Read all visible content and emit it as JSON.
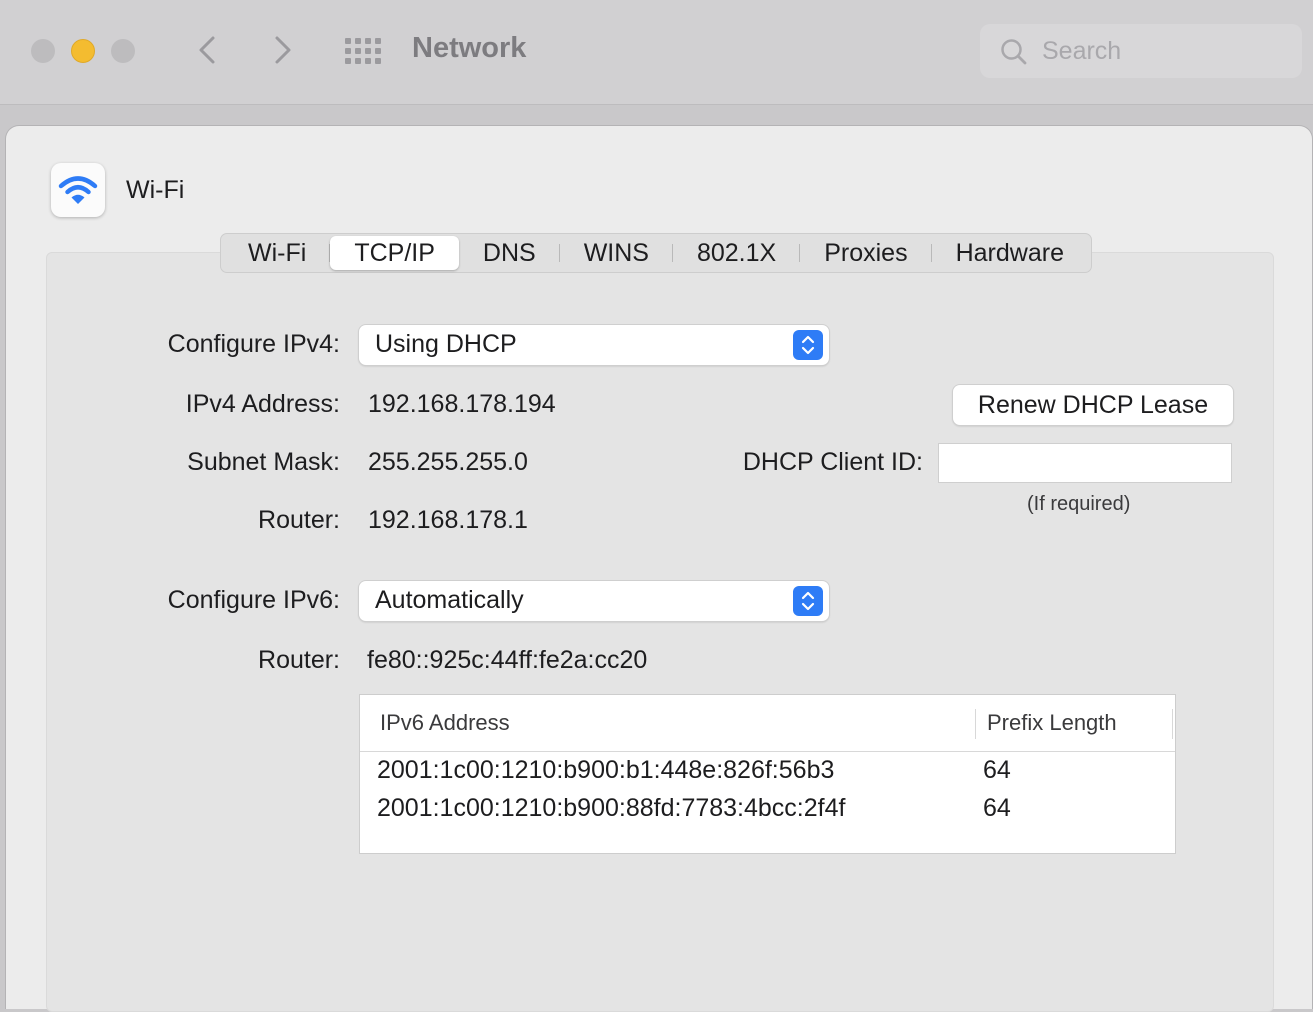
{
  "window": {
    "title": "Network",
    "search_placeholder": "Search"
  },
  "interface": {
    "name": "Wi-Fi",
    "icon": "wifi-icon"
  },
  "tabs": [
    {
      "label": "Wi-Fi",
      "active": false
    },
    {
      "label": "TCP/IP",
      "active": true
    },
    {
      "label": "DNS",
      "active": false
    },
    {
      "label": "WINS",
      "active": false
    },
    {
      "label": "802.1X",
      "active": false
    },
    {
      "label": "Proxies",
      "active": false
    },
    {
      "label": "Hardware",
      "active": false
    }
  ],
  "ipv4": {
    "configure_label": "Configure IPv4:",
    "configure_value": "Using DHCP",
    "address_label": "IPv4 Address:",
    "address_value": "192.168.178.194",
    "subnet_label": "Subnet Mask:",
    "subnet_value": "255.255.255.0",
    "router_label": "Router:",
    "router_value": "192.168.178.1",
    "renew_button": "Renew DHCP Lease",
    "client_id_label": "DHCP Client ID:",
    "client_id_value": "",
    "client_id_hint": "(If required)"
  },
  "ipv6": {
    "configure_label": "Configure IPv6:",
    "configure_value": "Automatically",
    "router_label": "Router:",
    "router_value": "fe80::925c:44ff:fe2a:cc20",
    "table": {
      "headers": [
        "IPv6 Address",
        "Prefix Length"
      ],
      "rows": [
        [
          "2001:1c00:1210:b900:b1:448e:826f:56b3",
          "64"
        ],
        [
          "2001:1c00:1210:b900:88fd:7783:4bcc:2f4f",
          "64"
        ]
      ]
    }
  },
  "colors": {
    "accent": "#2e7cf6",
    "minimize_light": "#f4bc30",
    "inactive_light": "#bdbcbe"
  }
}
